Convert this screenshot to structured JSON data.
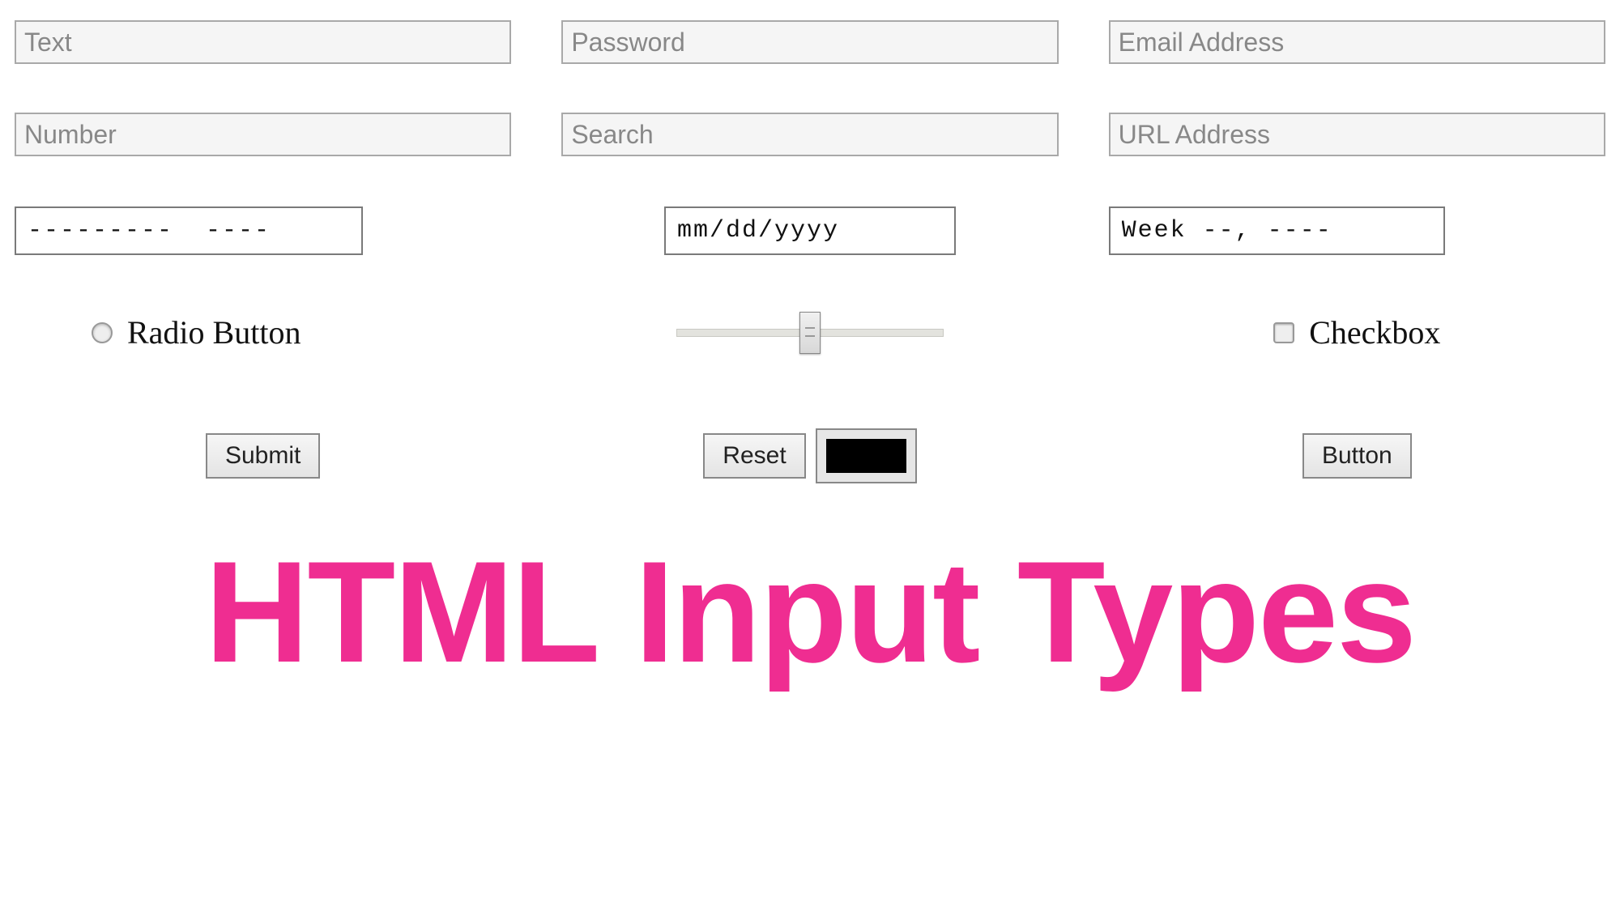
{
  "inputs": {
    "text": {
      "placeholder": "Text"
    },
    "password": {
      "placeholder": "Password"
    },
    "email": {
      "placeholder": "Email Address"
    },
    "number": {
      "placeholder": "Number"
    },
    "search": {
      "placeholder": "Search"
    },
    "url": {
      "placeholder": "URL Address"
    },
    "tel": {
      "value": "---------  ----"
    },
    "date": {
      "value": "mm/dd/yyyy"
    },
    "week": {
      "value": "Week --, ----"
    }
  },
  "controls": {
    "radio_label": "Radio Button",
    "checkbox_label": "Checkbox",
    "slider_value": 50,
    "slider_min": 0,
    "slider_max": 100
  },
  "buttons": {
    "submit_label": "Submit",
    "reset_label": "Reset",
    "button_label": "Button",
    "color_value": "#000000"
  },
  "title": "HTML Input Types",
  "colors": {
    "accent": "#ef2d91"
  }
}
